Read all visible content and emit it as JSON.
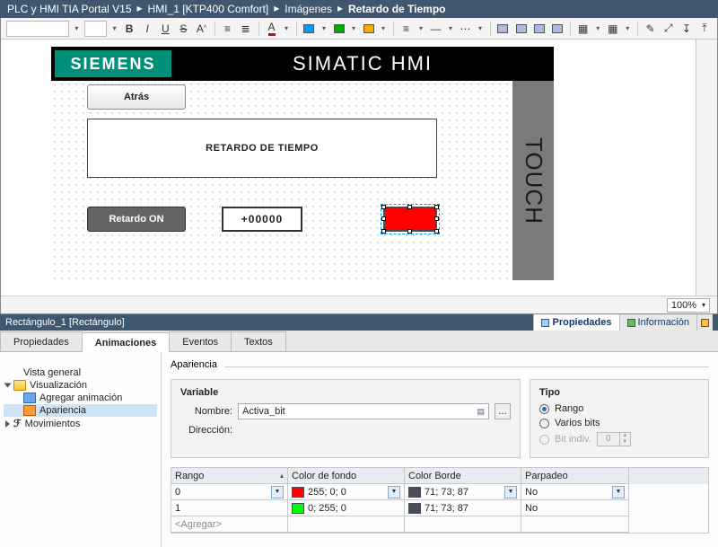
{
  "breadcrumb": [
    "PLC y HMI TIA Portal V15",
    "HMI_1 [KTP400 Comfort]",
    "Imágenes",
    "Retardo de Tiempo"
  ],
  "hmi": {
    "siemens": "SIEMENS",
    "simatic": "SIMATIC HMI",
    "touch": "TOUCH",
    "btn_atras": "Atrás",
    "frame_title": "RETARDO DE TIEMPO",
    "btn_retardo": "Retardo ON",
    "io_value": "+00000"
  },
  "zoom": "100%",
  "selection_bar": {
    "object": "Rectángulo_1 [Rectángulo]",
    "tabs": {
      "props": "Propiedades",
      "info": "Información"
    }
  },
  "main_tabs": {
    "props": "Propiedades",
    "anim": "Animaciones",
    "events": "Eventos",
    "texts": "Textos"
  },
  "tree": {
    "overview": "Vista general",
    "visualization": "Visualización",
    "add_anim": "Agregar animación",
    "appearance": "Apariencia",
    "movements": "Movimientos"
  },
  "appearance": {
    "heading": "Apariencia",
    "variable": {
      "heading": "Variable",
      "name_label": "Nombre:",
      "name_value": "Activa_bit",
      "addr_label": "Dirección:"
    },
    "tipo": {
      "heading": "Tipo",
      "rango": "Rango",
      "varios": "Varios bits",
      "bitindiv": "Bit indiv.",
      "bitindiv_val": "0"
    },
    "table": {
      "cols": {
        "rango": "Rango",
        "fondo": "Color de fondo",
        "borde": "Color Borde",
        "parp": "Parpadeo"
      },
      "rows": [
        {
          "rango": "0",
          "fondo_color": "#ff0000",
          "fondo_txt": "255; 0; 0",
          "borde_color": "#474d57",
          "borde_txt": "71; 73; 87",
          "parp": "No"
        },
        {
          "rango": "1",
          "fondo_color": "#00ff00",
          "fondo_txt": "0; 255; 0",
          "borde_color": "#474d57",
          "borde_txt": "71; 73; 87",
          "parp": "No"
        }
      ],
      "add": "<Agregar>"
    }
  }
}
